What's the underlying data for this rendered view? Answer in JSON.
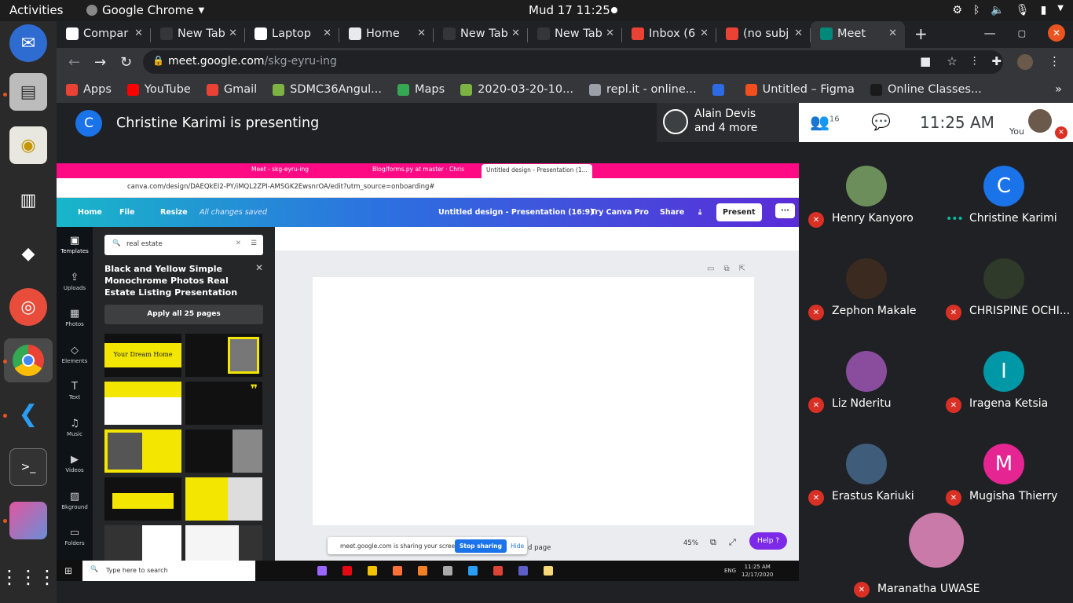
{
  "topbar": {
    "activities": "Activities",
    "app": "Google Chrome",
    "clock": "Mud 17  11:25"
  },
  "dock": {
    "apps": [
      "thunderbird-icon",
      "files-icon",
      "rhythmbox-icon",
      "libreoffice-writer-icon",
      "inkscape-icon",
      "help-icon",
      "chrome-icon",
      "vscode-icon",
      "terminal-icon",
      "screenshot-icon",
      "app-grid-icon"
    ]
  },
  "browser": {
    "tabs": [
      {
        "label": "Compar",
        "color": "#ffffff"
      },
      {
        "label": "New Tab",
        "color": "#35363a"
      },
      {
        "label": "Laptop",
        "color": "#ffffff"
      },
      {
        "label": "Home",
        "color": "#e8eaed"
      },
      {
        "label": "New Tab",
        "color": "#35363a"
      },
      {
        "label": "New Tab",
        "color": "#35363a"
      },
      {
        "label": "Inbox (6",
        "color": "#ea4335"
      },
      {
        "label": "(no subj",
        "color": "#ea4335"
      },
      {
        "label": "Meet",
        "color": "#00897b",
        "active": true
      }
    ],
    "url_host": "meet.google.com",
    "url_path": "/skg-eyru-ing",
    "bookmarks": [
      {
        "label": "Apps",
        "color": "#ea4335"
      },
      {
        "label": "YouTube",
        "color": "#ff0000"
      },
      {
        "label": "Gmail",
        "color": "#ea4335"
      },
      {
        "label": "SDMC36Angul...",
        "color": "#7cb342"
      },
      {
        "label": "Maps",
        "color": "#34a853"
      },
      {
        "label": "2020-03-20-10...",
        "color": "#7cb342"
      },
      {
        "label": "repl.it - online...",
        "color": "#9aa0a6"
      },
      {
        "label": "",
        "color": "#2d6be4"
      },
      {
        "label": "Untitled – Figma",
        "color": "#f24e1e"
      },
      {
        "label": "Online Classes...",
        "color": "#1a1a1a"
      }
    ]
  },
  "meet": {
    "presenter_initial": "C",
    "presenting_text": "Christine Karimi is presenting",
    "speakers_line1": "Alain Devis",
    "speakers_line2": "and 4 more",
    "people_count": "16",
    "time": "11:25 AM",
    "you_label": "You",
    "participants": [
      {
        "name": "Henry Kanyoro",
        "initial": "",
        "color": "#6b8e5a",
        "muted": true
      },
      {
        "name": "Christine Karimi",
        "initial": "C",
        "color": "#1a73e8",
        "muted": false
      },
      {
        "name": "Zephon Makale",
        "initial": "",
        "color": "#3b2a20",
        "muted": true
      },
      {
        "name": "CHRISPINE OCHI...",
        "initial": "",
        "color": "#2f3a2a",
        "muted": true
      },
      {
        "name": "Liz Nderitu",
        "initial": "",
        "color": "#8a4d9e",
        "muted": true
      },
      {
        "name": "Iragena Ketsia",
        "initial": "I",
        "color": "#0097a7",
        "muted": true
      },
      {
        "name": "Erastus Kariuki",
        "initial": "",
        "color": "#3f5d7a",
        "muted": true
      },
      {
        "name": "Mugisha Thierry",
        "initial": "M",
        "color": "#e52592",
        "muted": true
      }
    ],
    "last_participant": {
      "name": "Maranatha UWASE",
      "color": "#c97aa8"
    }
  },
  "shared_screen": {
    "tabs": [
      {
        "label": "Meet - skg-eyru-ing",
        "active": false
      },
      {
        "label": "Blog/forms.py at master · Chris",
        "active": false
      },
      {
        "label": "Untitled design - Presentation (1...",
        "active": true
      }
    ],
    "url": "canva.com/design/DAEQkEI2-PY/iMQL2ZPI-AMSGK2EwsnrOA/edit?utm_source=onboarding#",
    "toolbar": {
      "home": "Home",
      "file": "File",
      "resize": "Resize",
      "saved": "All changes saved",
      "doc_title": "Untitled design - Presentation (16:9)",
      "try_pro": "Try Canva Pro",
      "share": "Share",
      "present": "Present"
    },
    "sidebar": [
      {
        "label": "Templates",
        "glyph": "▣"
      },
      {
        "label": "Uploads",
        "glyph": "⇪"
      },
      {
        "label": "Photos",
        "glyph": "▦"
      },
      {
        "label": "Elements",
        "glyph": "◇"
      },
      {
        "label": "Text",
        "glyph": "T"
      },
      {
        "label": "Music",
        "glyph": "♫"
      },
      {
        "label": "Videos",
        "glyph": "▶"
      },
      {
        "label": "Bkground",
        "glyph": "▨"
      },
      {
        "label": "Folders",
        "glyph": "▭"
      }
    ],
    "search_value": "real estate",
    "template_title": "Black and Yellow Simple Monochrome Photos Real Estate Listing Presentation",
    "apply_label": "Apply all 25 pages",
    "thumb_text": "Your Dream Home",
    "sharing_text": "meet.google.com is sharing your screen.",
    "stop_sharing": "Stop sharing",
    "hide": "Hide",
    "add_page": "d page",
    "zoom": "45%",
    "help": "Help  ?",
    "taskbar_search": "Type here to search",
    "taskbar_lang": "ENG",
    "taskbar_time": "11:25 AM",
    "taskbar_date": "12/17/2020"
  }
}
